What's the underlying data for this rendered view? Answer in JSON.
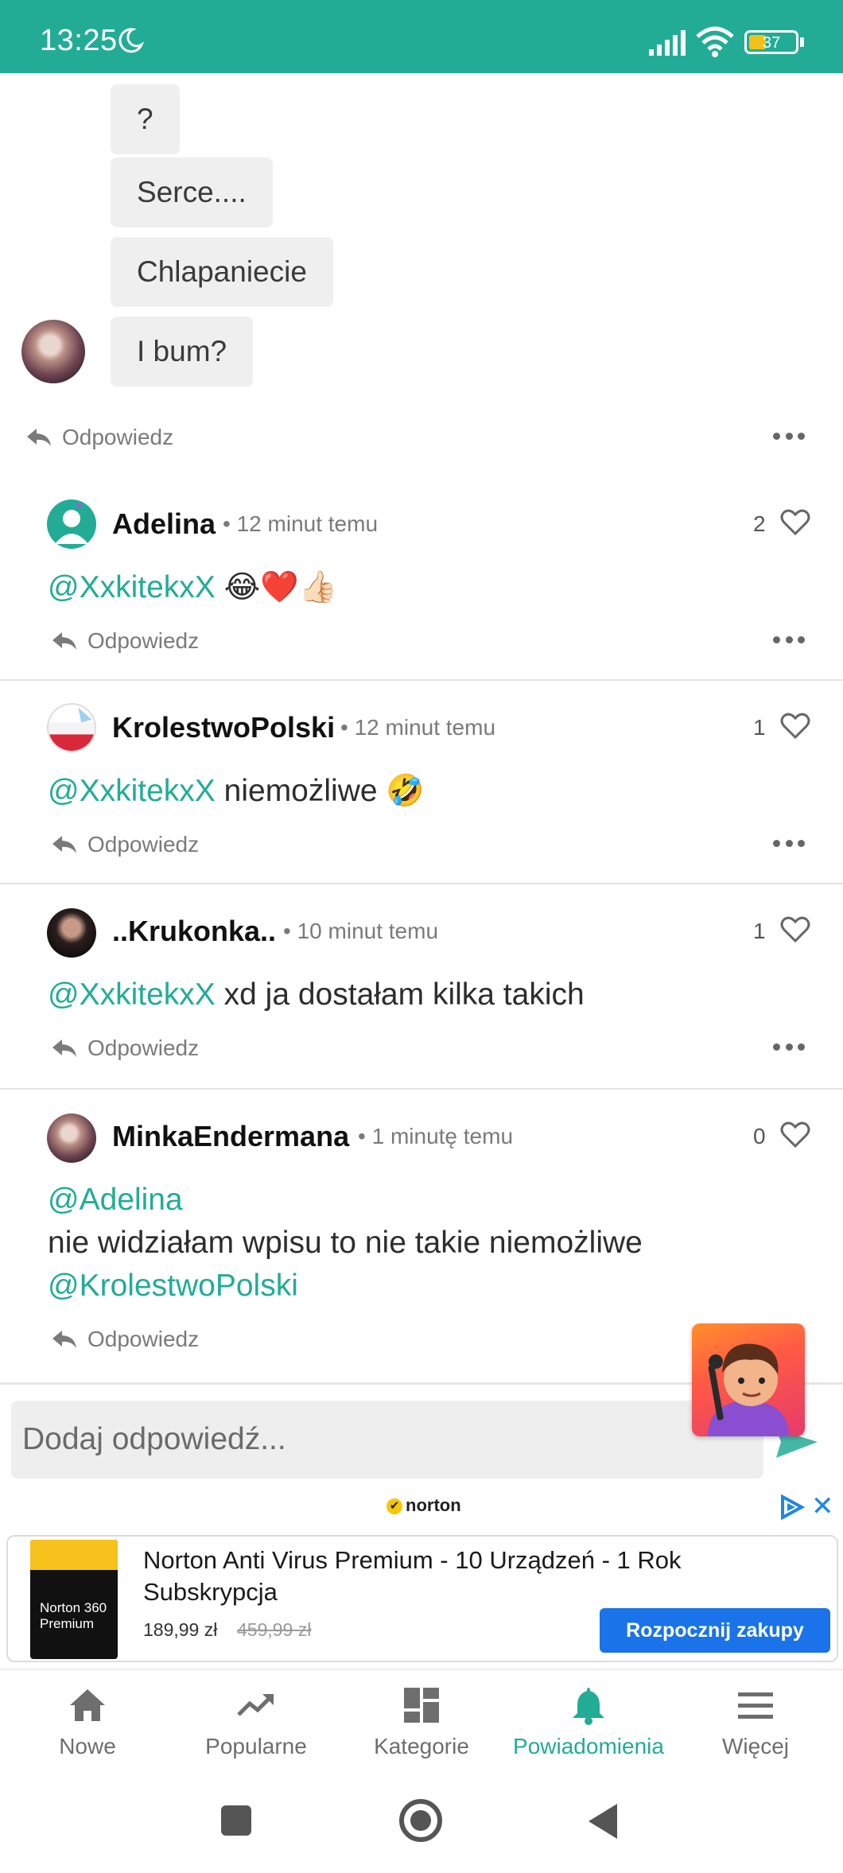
{
  "status_bar": {
    "time": "13:25",
    "battery": "37",
    "battery_level_percent": 37,
    "icons": [
      "moon-icon",
      "signal-icon",
      "wifi-icon",
      "battery-icon"
    ]
  },
  "thread": {
    "bubbles": [
      "?",
      "Serce....",
      "Chlapaniecie",
      "I bum?"
    ],
    "reply_label": "Odpowiedz"
  },
  "comments": [
    {
      "author": "Adelina",
      "time": "12 minut temu",
      "likes": "2",
      "body": [
        [
          {
            "t": "@XxkitekxX",
            "m": true
          },
          {
            "t": " 😂❤️👍🏻",
            "m": false
          }
        ]
      ]
    },
    {
      "author": "KrolestwoPolski",
      "time": "12 minut temu",
      "likes": "1",
      "body": [
        [
          {
            "t": "@XxkitekxX",
            "m": true
          },
          {
            "t": " niemożliwe 🤣",
            "m": false
          }
        ]
      ]
    },
    {
      "author": "..Krukonka..",
      "time": "10 minut temu",
      "likes": "1",
      "body": [
        [
          {
            "t": "@XxkitekxX",
            "m": true
          },
          {
            "t": " xd ja dostałam kilka takich",
            "m": false
          }
        ]
      ]
    },
    {
      "author": "MinkaEndermana",
      "time": "1 minutę temu",
      "likes": "0",
      "body": [
        [
          {
            "t": "@Adelina",
            "m": true
          }
        ],
        [
          {
            "t": "nie widziałam wpisu to nie takie niemożliwe",
            "m": false
          }
        ],
        [
          {
            "t": "@KrolestwoPolski",
            "m": true
          }
        ]
      ]
    }
  ],
  "reply_label": "Odpowiedz",
  "compose": {
    "placeholder": "Dodaj odpowiedź..."
  },
  "ad": {
    "brand": "norton",
    "product_label": "Norton 360 Premium",
    "title": "Norton Anti Virus Premium - 10 Urządzeń - 1 Rok Subskrypcja",
    "price": "189,99 zł",
    "old_price": "459,99 zł",
    "cta": "Rozpocznij zakupy"
  },
  "bottom_nav": {
    "items": [
      {
        "label": "Nowe",
        "icon": "home-icon"
      },
      {
        "label": "Popularne",
        "icon": "trending-icon"
      },
      {
        "label": "Kategorie",
        "icon": "dashboard-icon"
      },
      {
        "label": "Powiadomienia",
        "icon": "bell-icon",
        "active": true
      },
      {
        "label": "Więcej",
        "icon": "menu-icon"
      }
    ]
  },
  "colors": {
    "accent": "#22ac96",
    "bubble": "#efefef",
    "cta": "#1a73e8"
  }
}
